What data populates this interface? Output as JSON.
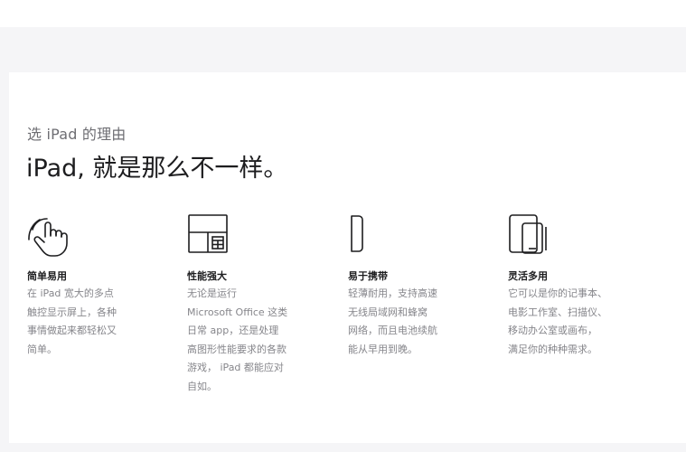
{
  "section": {
    "eyebrow": "选 iPad 的理由",
    "headline": "iPad, 就是那么不一样。"
  },
  "features": [
    {
      "icon": "touch-hand-icon",
      "title": "简单易用",
      "desc": "在 iPad 宽大的多点\n触控显示屏上，各种\n事情做起来都轻松又\n简单。"
    },
    {
      "icon": "multitask-layout-icon",
      "title": "性能强大",
      "desc": "无论是运行\nMicrosoft Office 这类\n日常 app，还是处理\n高图形性能要求的各款\n游戏， iPad 都能应对\n自如。"
    },
    {
      "icon": "thin-device-icon",
      "title": "易于携带",
      "desc": "轻薄耐用，支持高速\n无线局域网和蜂窝\n网络，而且电池续航\n能从早用到晚。"
    },
    {
      "icon": "devices-icon",
      "title": "灵活多用",
      "desc": "它可以是你的记事本、\n电影工作室、扫描仪、\n移动办公室或画布，\n满足你的种种需求。"
    }
  ]
}
